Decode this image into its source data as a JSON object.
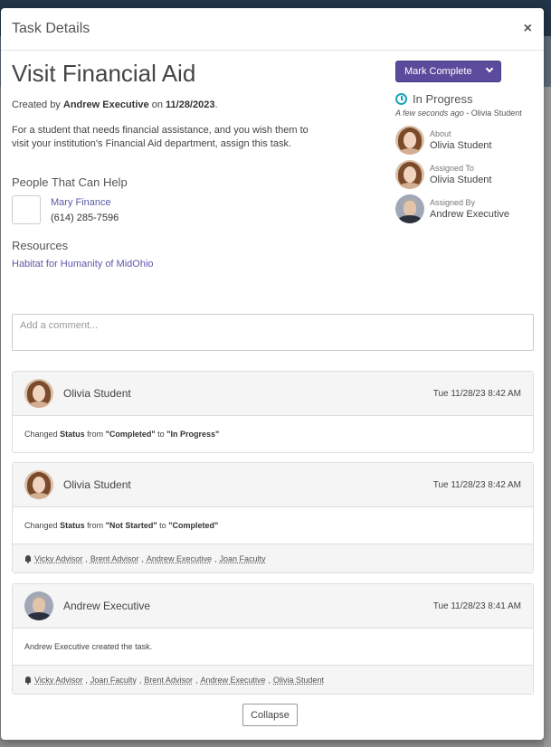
{
  "modal": {
    "title": "Task Details",
    "close_glyph": "×"
  },
  "task": {
    "title": "Visit Financial Aid",
    "created_prefix": "Created by",
    "created_by": "Andrew Executive",
    "created_on_word": "on",
    "created_date": "11/28/2023",
    "description": "For a student that needs financial assistance, and you wish them to visit your institution's Financial Aid department, assign this task."
  },
  "people": {
    "heading": "People That Can Help",
    "items": [
      {
        "name": "Mary Finance",
        "phone": "(614) 285-7596"
      }
    ]
  },
  "resources": {
    "heading": "Resources",
    "items": [
      "Habitat for Humanity of MidOhio"
    ]
  },
  "action": {
    "mark_complete_label": "Mark Complete"
  },
  "status": {
    "label": "In Progress",
    "when": "A few seconds ago",
    "by": "Olivia Student",
    "icon": "clock-icon",
    "color": "#1aa5b8"
  },
  "assignment": {
    "about_label": "About",
    "about_name": "Olivia Student",
    "assigned_to_label": "Assigned To",
    "assigned_to_name": "Olivia Student",
    "assigned_by_label": "Assigned By",
    "assigned_by_name": "Andrew Executive"
  },
  "comment": {
    "placeholder": "Add a comment..."
  },
  "activity": [
    {
      "author": "Olivia Student",
      "time": "Tue 11/28/23 8:42 AM",
      "text_pre": "Changed",
      "field": "Status",
      "from_word": "from",
      "from_value": "\"Completed\"",
      "to_word": "to",
      "to_value": "\"In Progress\""
    },
    {
      "author": "Olivia Student",
      "time": "Tue 11/28/23 8:42 AM",
      "text_pre": "Changed",
      "field": "Status",
      "from_word": "from",
      "from_value": "\"Not Started\"",
      "to_word": "to",
      "to_value": "\"Completed\"",
      "notified": [
        "Vicky Advisor",
        "Brent Advisor",
        "Andrew Executive",
        "Joan Faculty"
      ]
    },
    {
      "author": "Andrew Executive",
      "time": "Tue 11/28/23 8:41 AM",
      "text": "Andrew Executive created the task.",
      "notified": [
        "Vicky Advisor",
        "Joan Faculty",
        "Brent Advisor",
        "Andrew Executive",
        "Olivia Student"
      ]
    }
  ],
  "footer": {
    "collapse_label": "Collapse"
  },
  "colors": {
    "primary": "#5b4b9c",
    "link": "#5c5aa7"
  }
}
